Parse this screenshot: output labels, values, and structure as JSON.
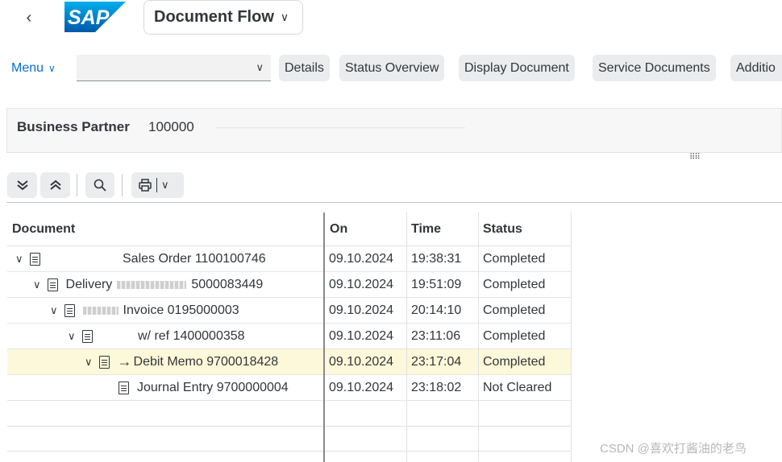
{
  "shell": {
    "back_icon": "chevron-left-icon",
    "logo_text": "SAP",
    "title": "Document Flow",
    "brand_color": "#0a6ed1"
  },
  "toolbar": {
    "menu_label": "Menu",
    "select_value": "",
    "buttons": [
      "Details",
      "Status Overview",
      "Display Document",
      "Service Documents",
      "Additio"
    ]
  },
  "header": {
    "partner_label": "Business Partner",
    "partner_value": "100000"
  },
  "icon_toolbar": {
    "icons": [
      "expand-all-icon",
      "collapse-all-icon",
      "search-icon",
      "print-icon"
    ]
  },
  "table": {
    "columns": [
      "Document",
      "On",
      "Time",
      "Status"
    ],
    "rows": [
      {
        "document": "Sales Order 1100100746",
        "on": "09.10.2024",
        "time": "19:38:31",
        "status": "Completed",
        "level": 0,
        "expandable": true,
        "selected": false
      },
      {
        "document": "5000083449",
        "prefix": "Delivery",
        "on": "09.10.2024",
        "time": "19:51:09",
        "status": "Completed",
        "level": 1,
        "expandable": true,
        "selected": false
      },
      {
        "document": "Invoice 0195000003",
        "on": "09.10.2024",
        "time": "20:14:10",
        "status": "Completed",
        "level": 2,
        "expandable": true,
        "selected": false
      },
      {
        "document": "w/ ref 1400000358",
        "on": "09.10.2024",
        "time": "23:11:06",
        "status": "Completed",
        "level": 3,
        "expandable": true,
        "selected": false
      },
      {
        "document": "Debit Memo 9700018428",
        "on": "09.10.2024",
        "time": "23:17:04",
        "status": "Completed",
        "level": 4,
        "expandable": true,
        "selected": true
      },
      {
        "document": "Journal Entry 9700000004",
        "on": "09.10.2024",
        "time": "23:18:02",
        "status": "Not Cleared",
        "level": 5,
        "expandable": false,
        "selected": false
      }
    ],
    "selection_color": "#fdf8d9"
  },
  "watermark": "CSDN @喜欢打酱油的老鸟"
}
